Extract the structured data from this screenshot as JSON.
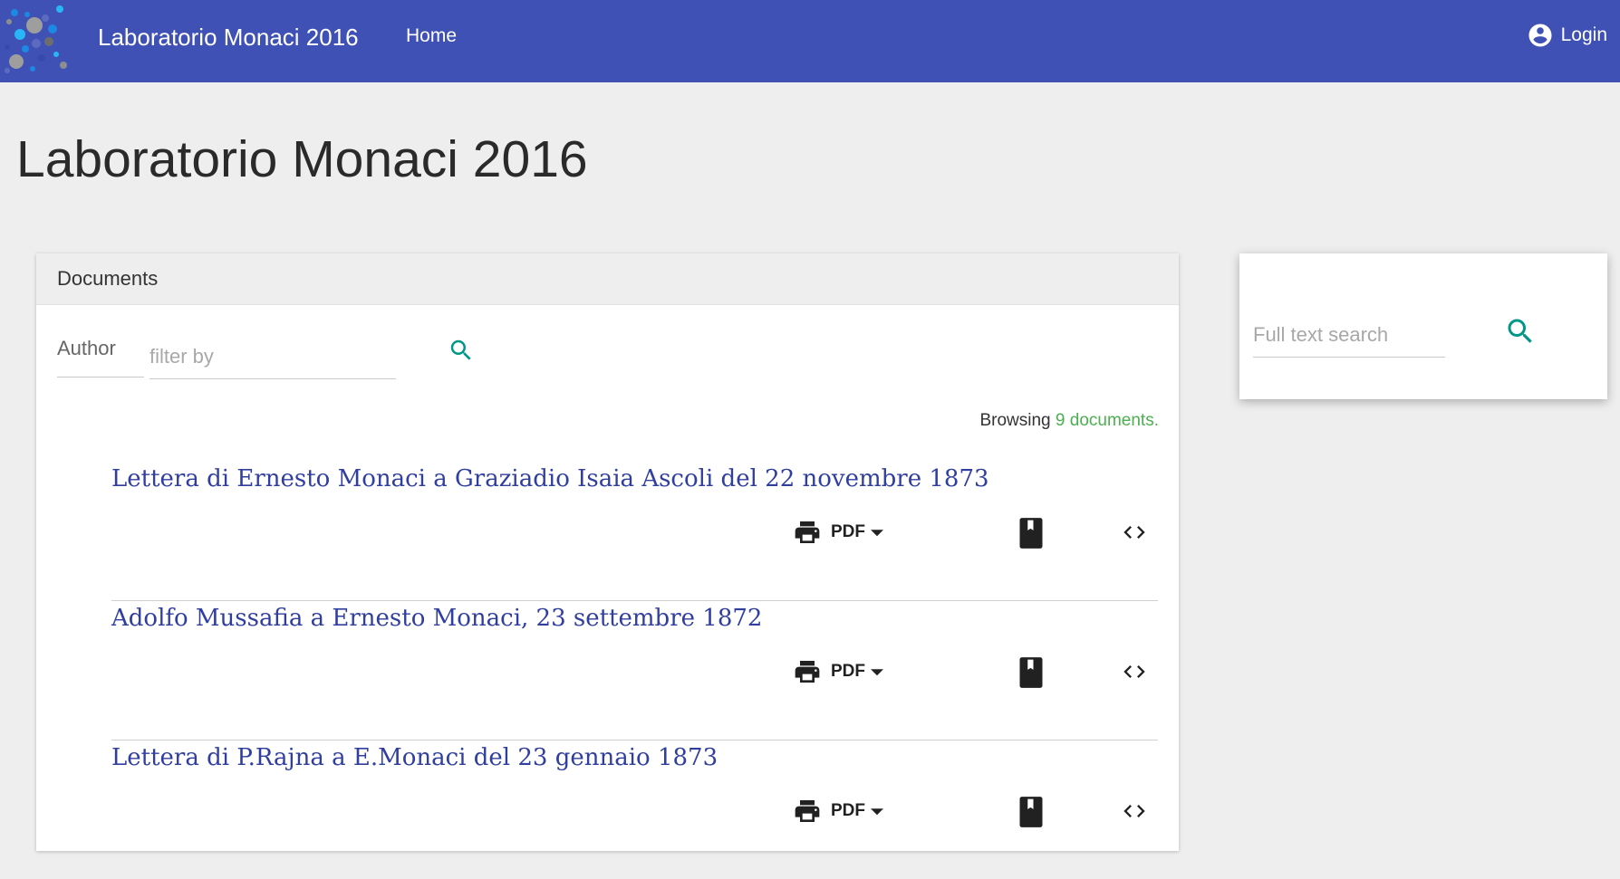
{
  "appbar": {
    "title": "Laboratorio Monaci 2016",
    "nav": {
      "home_label": "Home"
    },
    "login_label": "Login"
  },
  "page": {
    "title": "Laboratorio Monaci 2016"
  },
  "documents_panel": {
    "header": "Documents",
    "filter": {
      "field_label": "Author",
      "placeholder": "filter by",
      "value": ""
    },
    "browsing": {
      "prefix": "Browsing",
      "count_text": "9 documents."
    },
    "items": [
      {
        "title": "Lettera di Ernesto Monaci a Graziadio Isaia Ascoli del 22 novembre 1873",
        "pdf_label": "PDF"
      },
      {
        "title": "Adolfo Mussafia a Ernesto Monaci, 23 settembre 1872",
        "pdf_label": "PDF"
      },
      {
        "title": "Lettera di P.Rajna a E.Monaci del 23 gennaio 1873",
        "pdf_label": "PDF"
      }
    ]
  },
  "search_panel": {
    "placeholder": "Full text search",
    "value": ""
  },
  "colors": {
    "appbar": "#3f51b5",
    "link": "#303f9f",
    "search_icon": "#009688",
    "count": "#4caf50",
    "background": "#eeeeee"
  },
  "icons": {
    "logo": "dotted-x-logo",
    "login": "account-circle-icon",
    "search": "magnifier-icon",
    "print": "printer-icon",
    "dropdown": "caret-down-icon",
    "book": "book-icon",
    "code": "code-brackets-icon"
  }
}
